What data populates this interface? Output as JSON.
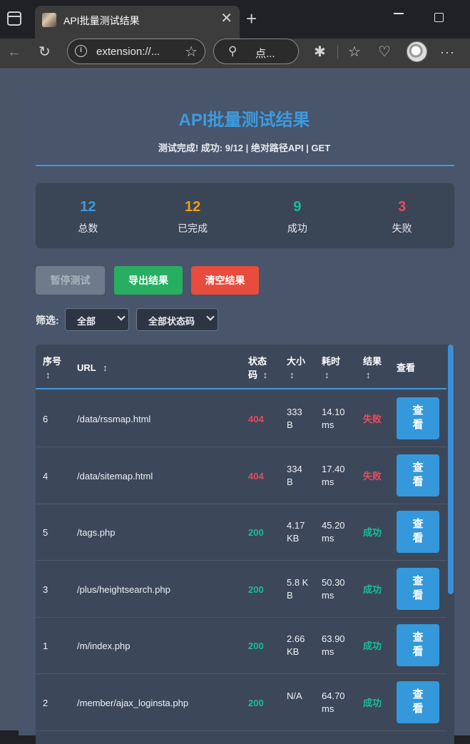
{
  "browser": {
    "tab_title": "API批量测试结果",
    "address": "extension://...",
    "search_text": "点...",
    "close_glyph": "✕",
    "new_tab_glyph": "+"
  },
  "page": {
    "title": "API批量测试结果",
    "subtitle": "测试完成! 成功: 9/12 | 绝对路径API | GET"
  },
  "stats": [
    {
      "value": "12",
      "label": "总数",
      "color": "#3b9be0"
    },
    {
      "value": "12",
      "label": "已完成",
      "color": "#f39c12"
    },
    {
      "value": "9",
      "label": "成功",
      "color": "#1abc9c"
    },
    {
      "value": "3",
      "label": "失败",
      "color": "#e74c5c"
    }
  ],
  "buttons": {
    "pause": "暂停测试",
    "export": "导出结果",
    "clear": "清空结果"
  },
  "filter": {
    "label": "筛选:",
    "result_select": "全部",
    "status_select": "全部状态码"
  },
  "table": {
    "headers": {
      "idx": "序号",
      "url": "URL",
      "code_line1": "状态",
      "code_line2": "码",
      "size": "大小",
      "time": "耗时",
      "result": "结果",
      "view": "查看",
      "sort_glyph": "↕"
    },
    "view_label_1": "查",
    "view_label_2": "看",
    "colors": {
      "fail": "#e74c5c",
      "ok": "#1abc9c"
    },
    "rows": [
      {
        "idx": "6",
        "url": "/data/rssmap.html",
        "code": "404",
        "size": "333 B",
        "time": "14.10 ms",
        "result": "失败",
        "ok": false
      },
      {
        "idx": "4",
        "url": "/data/sitemap.html",
        "code": "404",
        "size": "334 B",
        "time": "17.40 ms",
        "result": "失败",
        "ok": false
      },
      {
        "idx": "5",
        "url": "/tags.php",
        "code": "200",
        "size": "4.17 KB",
        "time": "45.20 ms",
        "result": "成功",
        "ok": true
      },
      {
        "idx": "3",
        "url": "/plus/heightsearch.php",
        "code": "200",
        "size": "5.8 KB",
        "time": "50.30 ms",
        "result": "成功",
        "ok": true
      },
      {
        "idx": "1",
        "url": "/m/index.php",
        "code": "200",
        "size": "2.66 KB",
        "time": "63.90 ms",
        "result": "成功",
        "ok": true
      },
      {
        "idx": "2",
        "url": "/member/ajax_loginsta.php",
        "code": "200",
        "size": "N/A",
        "time": "64.70 ms",
        "result": "成功",
        "ok": true
      }
    ]
  }
}
